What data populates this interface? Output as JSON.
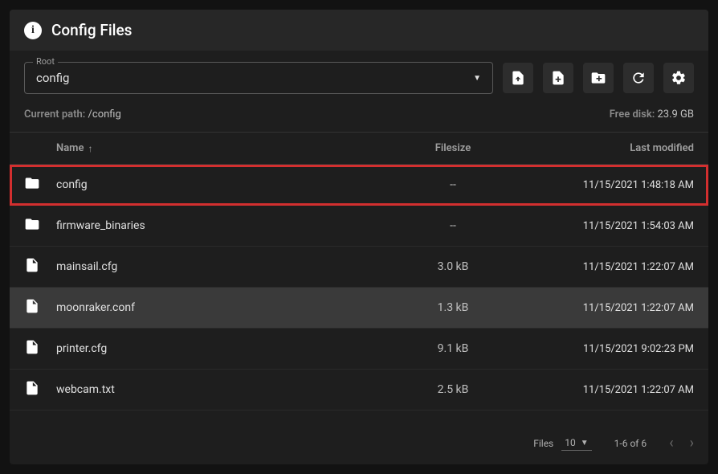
{
  "header": {
    "title": "Config Files"
  },
  "root": {
    "label": "Root",
    "value": "config"
  },
  "path": {
    "label": "Current path:",
    "value": "/config"
  },
  "disk": {
    "label": "Free disk:",
    "value": "23.9 GB"
  },
  "columns": {
    "name": "Name",
    "filesize": "Filesize",
    "last_modified": "Last modified"
  },
  "rows": [
    {
      "type": "folder",
      "name": "config",
      "size": "--",
      "modified": "11/15/2021 1:48:18 AM",
      "highlight": true,
      "hover": false
    },
    {
      "type": "folder",
      "name": "firmware_binaries",
      "size": "--",
      "modified": "11/15/2021 1:54:03 AM",
      "highlight": false,
      "hover": false
    },
    {
      "type": "file",
      "name": "mainsail.cfg",
      "size": "3.0 kB",
      "modified": "11/15/2021 1:22:07 AM",
      "highlight": false,
      "hover": false
    },
    {
      "type": "file",
      "name": "moonraker.conf",
      "size": "1.3 kB",
      "modified": "11/15/2021 1:22:07 AM",
      "highlight": false,
      "hover": true
    },
    {
      "type": "file",
      "name": "printer.cfg",
      "size": "9.1 kB",
      "modified": "11/15/2021 9:02:23 PM",
      "highlight": false,
      "hover": false
    },
    {
      "type": "file",
      "name": "webcam.txt",
      "size": "2.5 kB",
      "modified": "11/15/2021 1:22:07 AM",
      "highlight": false,
      "hover": false
    }
  ],
  "pager": {
    "label": "Files",
    "page_size": "10",
    "range": "1-6 of 6"
  }
}
